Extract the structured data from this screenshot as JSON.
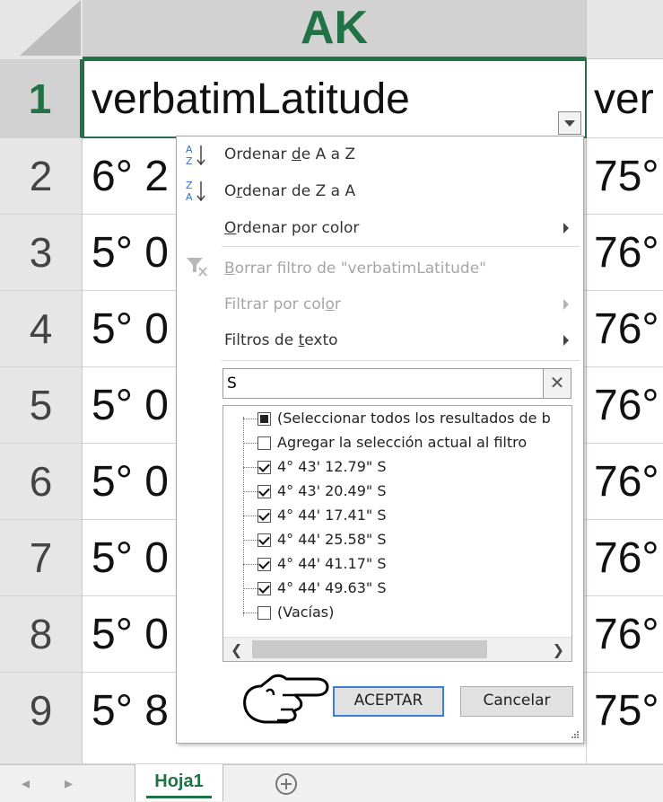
{
  "column_header": {
    "selected": "AK"
  },
  "row_headers": [
    "1",
    "2",
    "3",
    "4",
    "5",
    "6",
    "7",
    "8",
    "9"
  ],
  "column_ak_cells": [
    "verbatimLatitude",
    "6° 2",
    "5° 0",
    "5° 0",
    "5° 0",
    "5° 0",
    "5° 0",
    "5° 0",
    "5° 8"
  ],
  "next_column_cells": [
    "ver",
    "75°",
    "76°",
    "76°",
    "76°",
    "76°",
    "76°",
    "76°",
    "75°"
  ],
  "filter_menu": {
    "sort_asc": {
      "pre": "Ordenar ",
      "key": "d",
      "post": "e A a Z"
    },
    "sort_desc": {
      "pre": "O",
      "key": "r",
      "post": "denar de Z a A"
    },
    "sort_by_color": {
      "pre": "",
      "key": "O",
      "post": "rdenar por color"
    },
    "clear_filter": {
      "pre": "",
      "key": "B",
      "post": "orrar filtro de \"verbatimLatitude\""
    },
    "filter_by_color": {
      "pre": "Filtrar por col",
      "key": "o",
      "post": "r"
    },
    "text_filters": {
      "pre": "Filtros de ",
      "key": "t",
      "post": "exto"
    },
    "search_value": "S",
    "list_items": [
      {
        "label": "(Seleccionar todos los resultados de b",
        "state": "partial"
      },
      {
        "label": "Agregar la selección actual al filtro",
        "state": "unchecked"
      },
      {
        "label": "4° 43' 12.79\" S",
        "state": "checked"
      },
      {
        "label": "4° 43' 20.49\" S",
        "state": "checked"
      },
      {
        "label": "4° 44' 17.41\" S",
        "state": "checked"
      },
      {
        "label": "4° 44' 25.58\" S",
        "state": "checked"
      },
      {
        "label": "4° 44' 41.17\" S",
        "state": "checked"
      },
      {
        "label": "4° 44' 49.63\" S",
        "state": "checked"
      },
      {
        "label": "(Vacías)",
        "state": "unchecked"
      }
    ],
    "ok_label": "ACEPTAR",
    "cancel_label": "Cancelar"
  },
  "sheet_tabs": {
    "active": "Hoja1"
  },
  "icons": {
    "sort_asc": "sort-a-z-icon",
    "sort_desc": "sort-z-a-icon",
    "clear_filter": "clear-filter-icon",
    "pointer": "pointing-hand-icon",
    "add_sheet": "plus-circle-icon"
  },
  "colors": {
    "excel_green": "#217346",
    "selected_header": "#d2d2d2",
    "focus_blue": "#3c7fd6"
  }
}
